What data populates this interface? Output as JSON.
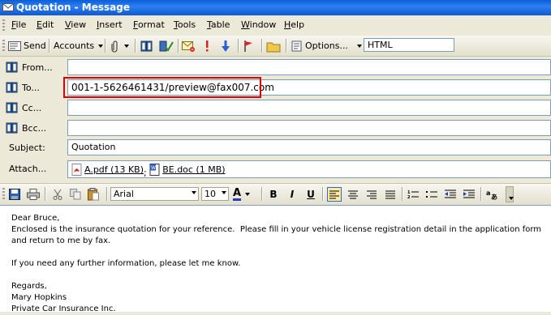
{
  "window": {
    "title": "Quotation - Message"
  },
  "menu": [
    "File",
    "Edit",
    "View",
    "Insert",
    "Format",
    "Tools",
    "Table",
    "Window",
    "Help"
  ],
  "toolbar": {
    "send_label": "Send",
    "accounts_label": "Accounts",
    "options_label": "Options...",
    "format_value": "HTML"
  },
  "fields": {
    "from_label": "From...",
    "from_value": "",
    "to_label": "To...",
    "to_value": "001-1-5626461431/preview@fax007.com",
    "cc_label": "Cc...",
    "cc_value": "",
    "bcc_label": "Bcc...",
    "bcc_value": "",
    "subject_label": "Subject:",
    "subject_value": "Quotation",
    "attach_label": "Attach..."
  },
  "attachments": [
    {
      "name": "A.pdf (13 KB)",
      "icon": "pdf-icon"
    },
    {
      "name": "BE.doc (1 MB)",
      "icon": "word-doc-icon"
    }
  ],
  "formatting": {
    "font": "Arial",
    "size": "10",
    "bold_label": "B",
    "italic_label": "I",
    "underline_label": "U",
    "font_color_label": "A"
  },
  "body": {
    "lines": [
      "Dear Bruce,",
      "Enclosed is the insurance quotation for your reference.  Please fill in your vehicle license registration detail in the application form",
      "and return to me by fax.",
      "",
      "If you need any further information, please let me know.",
      "",
      "Regards,",
      "Mary Hopkins",
      "Private Car Insurance Inc."
    ]
  },
  "colors": {
    "titlebar": "#0a5fd8",
    "highlight": "#e00000",
    "field_border": "#7f9db9"
  }
}
